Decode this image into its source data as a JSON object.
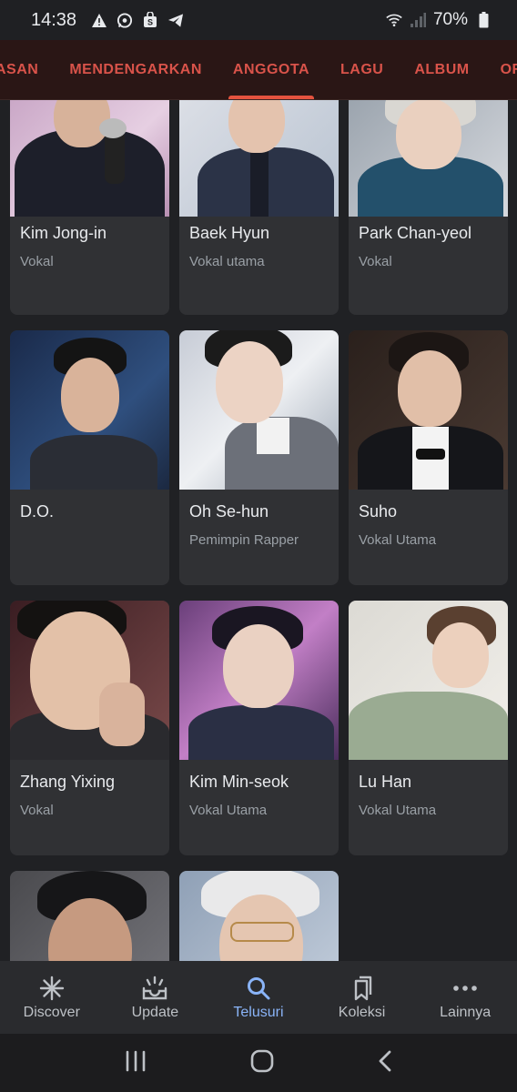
{
  "status_bar": {
    "time": "14:38",
    "battery": "70%",
    "icons": [
      "warning-icon",
      "whatsapp-icon",
      "shop-icon",
      "telegram-icon",
      "wifi-icon",
      "signal-icon",
      "battery-icon"
    ]
  },
  "tabs": [
    {
      "label": "ASAN"
    },
    {
      "label": "MENDENGARKAN"
    },
    {
      "label": "ANGGOTA",
      "active": true
    },
    {
      "label": "LAGU"
    },
    {
      "label": "ALBUM"
    },
    {
      "label": "ORAN"
    }
  ],
  "members": [
    {
      "name": "Kim Jong-in",
      "role": "Vokal"
    },
    {
      "name": "Baek Hyun",
      "role": "Vokal utama"
    },
    {
      "name": "Park Chan-yeol",
      "role": "Vokal"
    },
    {
      "name": "D.O.",
      "role": ""
    },
    {
      "name": "Oh Se-hun",
      "role": "Pemimpin Rapper"
    },
    {
      "name": "Suho",
      "role": "Vokal Utama"
    },
    {
      "name": "Zhang Yixing",
      "role": "Vokal"
    },
    {
      "name": "Kim Min-seok",
      "role": "Vokal Utama"
    },
    {
      "name": "Lu Han",
      "role": "Vokal Utama"
    },
    {
      "name": "",
      "role": ""
    },
    {
      "name": "",
      "role": ""
    }
  ],
  "bottom_nav": [
    {
      "label": "Discover",
      "icon": "asterisk-icon"
    },
    {
      "label": "Update",
      "icon": "update-tray-icon"
    },
    {
      "label": "Telusuri",
      "icon": "search-icon",
      "active": true
    },
    {
      "label": "Koleksi",
      "icon": "bookmarks-icon"
    },
    {
      "label": "Lainnya",
      "icon": "more-dots-icon"
    }
  ],
  "colors": {
    "tab_text": "#d9534a",
    "tab_indicator": "#e5533f",
    "active_nav": "#8ab4f8",
    "card_bg": "#303134"
  }
}
